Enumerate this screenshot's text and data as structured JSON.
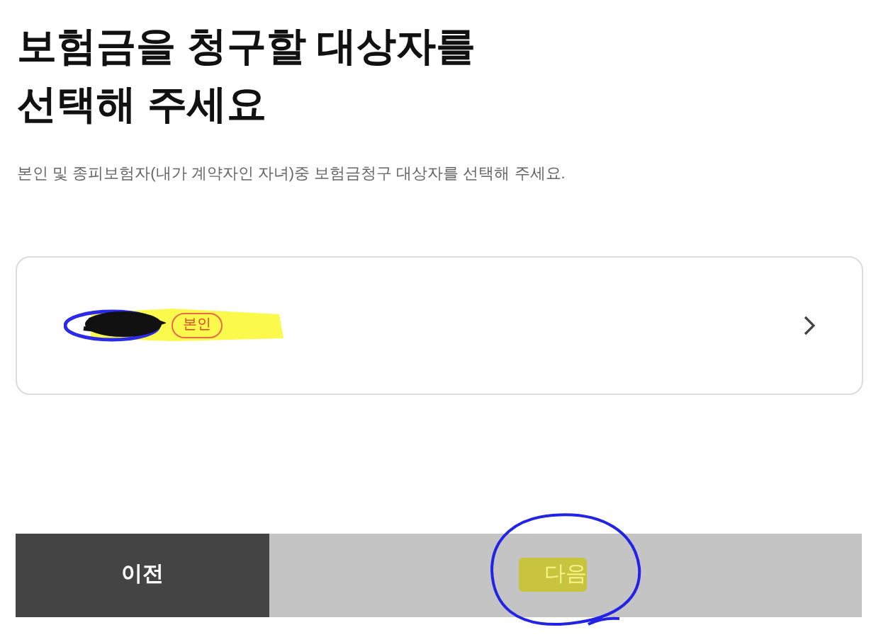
{
  "title": "보험금을 청구할 대상자를\n선택해 주세요",
  "description": "본인 및 종피보험자(내가 계약자인 자녀)중 보험금청구 대상자를 선택해 주세요.",
  "people": [
    {
      "badge": "본인",
      "name_redacted": true
    }
  ],
  "buttons": [
    {
      "label": "이전",
      "kind": "prev",
      "disabled": false
    },
    {
      "label": "다음",
      "kind": "next",
      "disabled": true
    }
  ]
}
